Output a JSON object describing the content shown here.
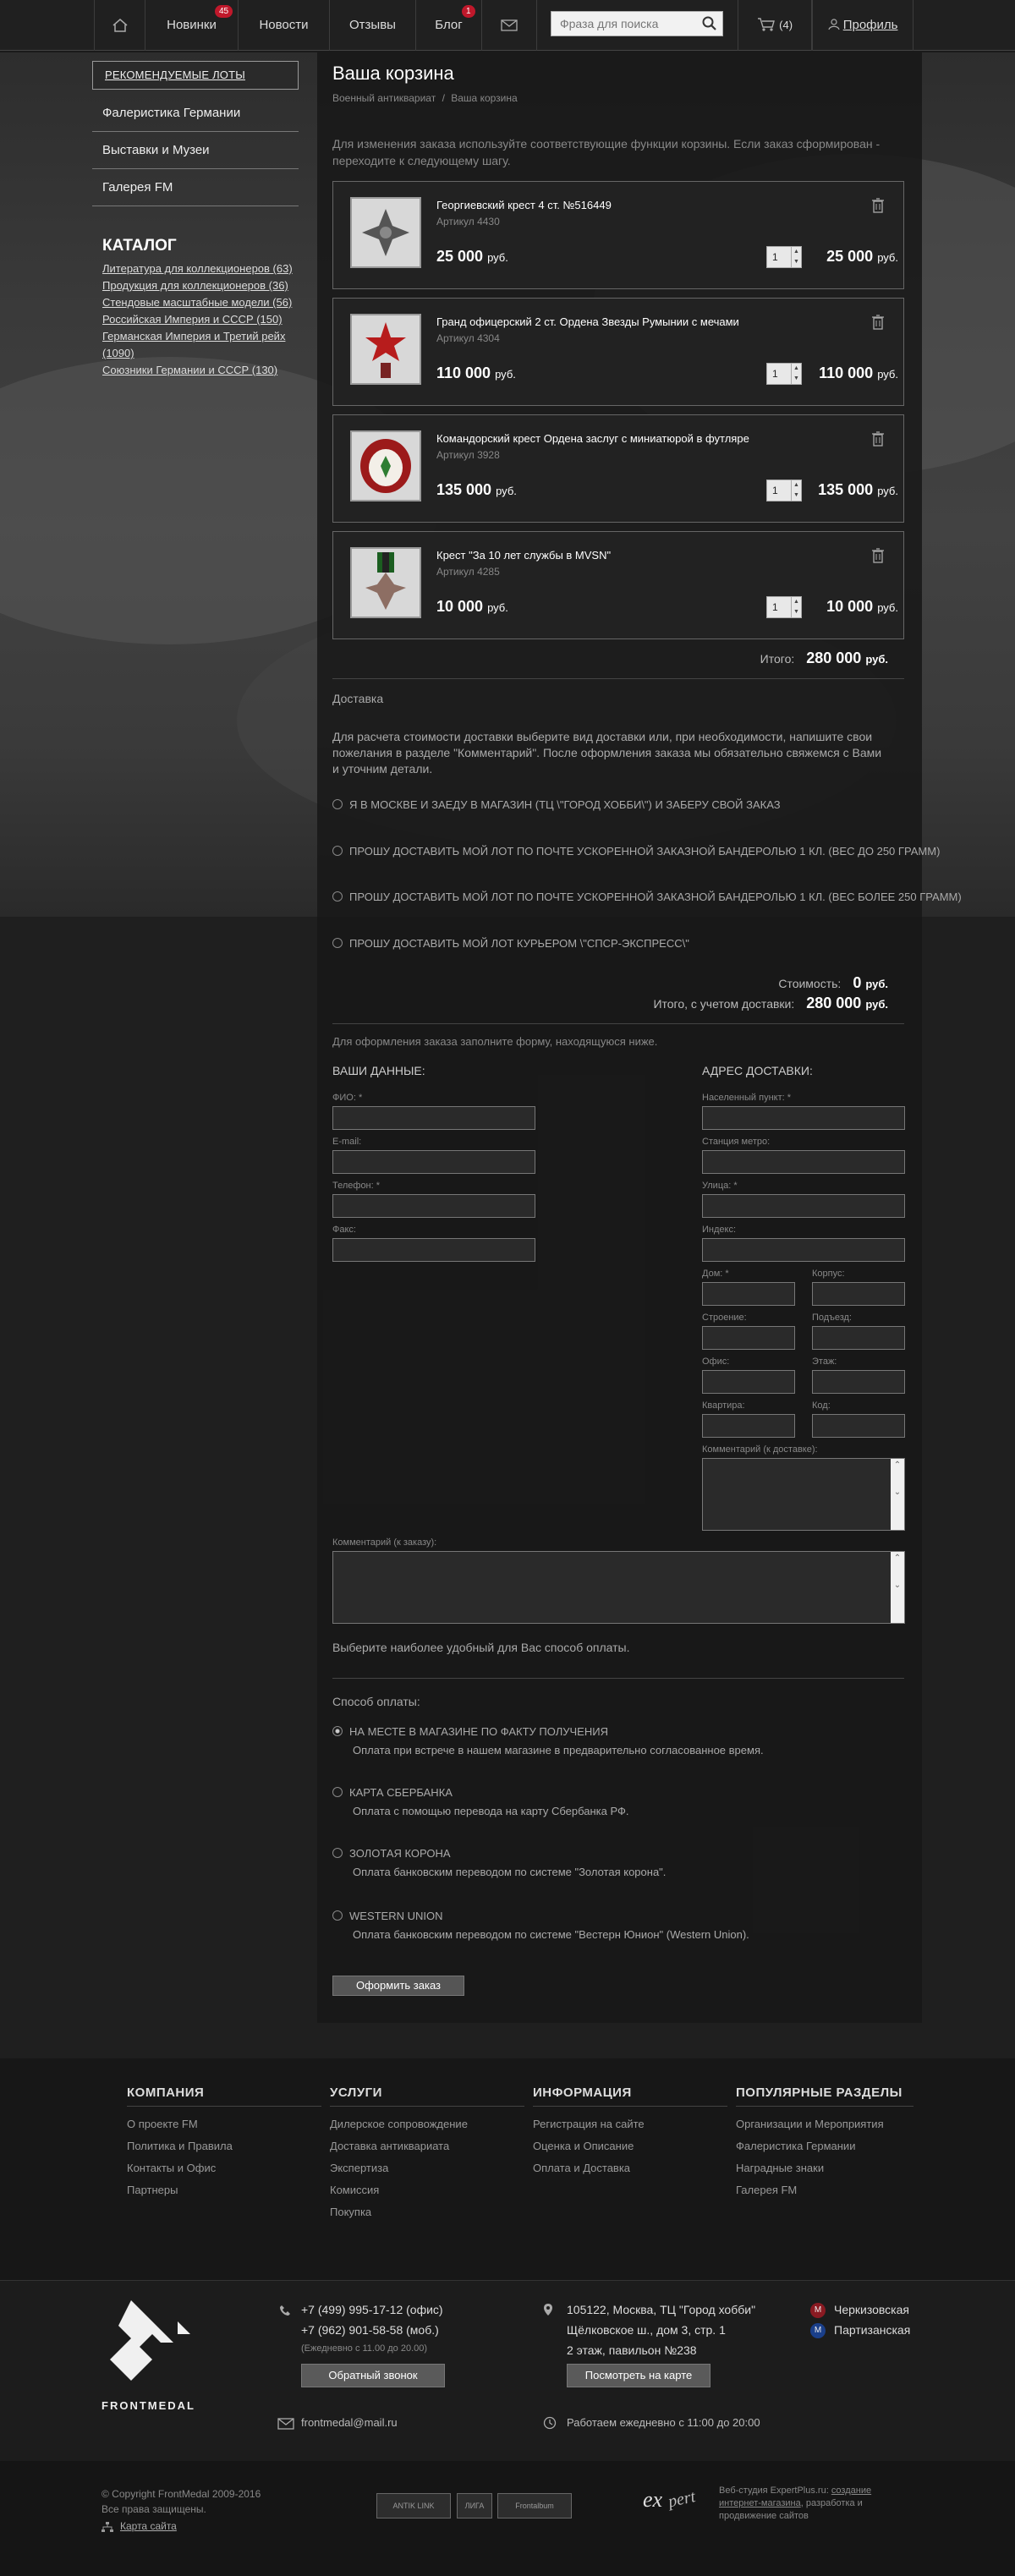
{
  "nav": {
    "items": [
      {
        "label": "Новинки",
        "badge": "45"
      },
      {
        "label": "Новости"
      },
      {
        "label": "Отзывы"
      },
      {
        "label": "Блог",
        "badge": "1"
      }
    ],
    "search_placeholder": "Фраза для поиска",
    "cart_count": "(4)",
    "profile_label": "Профиль"
  },
  "sidebar": {
    "recommended": "РЕКОМЕНДУЕМЫЕ ЛОТЫ",
    "links": [
      "Фалеристика Германии",
      "Выставки и Музеи",
      "Галерея FM"
    ],
    "catalog_title": "КАТАЛОГ",
    "catalog": [
      "Литература для коллекционеров (63)",
      "Продукция для коллекционеров (36)",
      "Стендовые масштабные модели (56)",
      "Российская Империя и СССР (150)",
      "Германская Империя и Третий рейх",
      "(1090)",
      "Союзники Германии и СССР (130)"
    ]
  },
  "cart": {
    "title": "Ваша корзина",
    "breadcrumb": [
      "Военный антиквариат",
      "/",
      "Ваша корзина"
    ],
    "intro": "Для изменения заказа используйте соответствующие функции корзины. Если заказ сформирован - переходите к следующему шагу.",
    "items": [
      {
        "name": "Георгиевский крест 4 ст. №516449",
        "article": "Артикул 4430",
        "price": "25 000",
        "currency": "руб.",
        "qty": "1",
        "total": "25 000"
      },
      {
        "name": "Гранд офицерский 2 ст. Ордена Звезды Румынии с мечами",
        "article": "Артикул 4304",
        "price": "110 000",
        "currency": "руб.",
        "qty": "1",
        "total": "110 000"
      },
      {
        "name": "Командорский крест Ордена заслуг с миниатюрой в футляре",
        "article": "Артикул 3928",
        "price": "135 000",
        "currency": "руб.",
        "qty": "1",
        "total": "135 000"
      },
      {
        "name": "Крест \"За 10 лет службы в MVSN\"",
        "article": "Артикул 4285",
        "price": "10 000",
        "currency": "руб.",
        "qty": "1",
        "total": "10 000"
      }
    ],
    "total_label": "Итого:",
    "total_value": "280 000",
    "currency": "руб."
  },
  "delivery": {
    "title": "Доставка",
    "text": "Для расчета стоимости доставки выберите вид доставки или, при необходимости, напишите свои пожелания в разделе \"Комментарий\". После оформления заказа мы обязательно свяжемся с Вами и уточним детали.",
    "options": [
      "Я В МОСКВЕ И ЗАЕДУ В МАГАЗИН (ТЦ \\\"ГОРОД ХОББИ\\\") И ЗАБЕРУ СВОЙ ЗАКАЗ",
      "ПРОШУ ДОСТАВИТЬ МОЙ ЛОТ ПО ПОЧТЕ УСКОРЕННОЙ ЗАКАЗНОЙ БАНДЕРОЛЬЮ 1 КЛ. (ВЕС ДО 250 ГРАММ)",
      "ПРОШУ ДОСТАВИТЬ МОЙ ЛОТ ПО ПОЧТЕ УСКОРЕННОЙ ЗАКАЗНОЙ БАНДЕРОЛЬЮ 1 КЛ. (ВЕС БОЛЕЕ 250 ГРАММ)",
      "ПРОШУ ДОСТАВИТЬ МОЙ ЛОТ КУРЬЕРОМ \\\"СПСР-ЭКСПРЕСС\\\""
    ],
    "cost_label": "Стоимость:",
    "cost_value": "0",
    "grand_label": "Итого, с учетом доставки:",
    "grand_value": "280 000",
    "currency": "руб."
  },
  "form": {
    "intro": "Для оформления заказа заполните форму, находящуюся ниже.",
    "your_data": "ВАШИ ДАННЫЕ:",
    "address_title": "АДРЕС ДОСТАВКИ:",
    "left_fields": [
      "ФИО: *",
      "E-mail:",
      "Телефон: *",
      "Факс:"
    ],
    "right_fields": [
      "Населенный пункт: *",
      "Станция метро:",
      "Улица: *",
      "Индекс:"
    ],
    "pairs": [
      [
        "Дом: *",
        "Корпус:"
      ],
      [
        "Строение:",
        "Подъезд:"
      ],
      [
        "Офис:",
        "Этаж:"
      ],
      [
        "Квартира:",
        "Код:"
      ]
    ],
    "delivery_comment": "Комментарий (к доставке):",
    "order_comment": "Комментарий (к заказу):"
  },
  "payment": {
    "prompt": "Выберите наиболее удобный для Вас способ оплаты.",
    "title": "Способ оплаты:",
    "options": [
      {
        "label": "НА МЕСТЕ В МАГАЗИНЕ ПО ФАКТУ ПОЛУЧЕНИЯ",
        "desc": "Оплата при встрече в нашем магазине в предварительно согласованное время."
      },
      {
        "label": "КАРТА СБЕРБАНКА",
        "desc": "Оплата с помощью перевода на карту Сбербанка РФ."
      },
      {
        "label": "ЗОЛОТАЯ КОРОНА",
        "desc": "Оплата банковским переводом по системе \"Золотая корона\"."
      },
      {
        "label": "WESTERN UNION",
        "desc": "Оплата банковским переводом по системе \"Вестерн Юнион\" (Western Union)."
      }
    ],
    "submit": "Оформить заказ"
  },
  "footer": {
    "columns": [
      {
        "title": "КОМПАНИЯ",
        "links": [
          "О проекте FM",
          "Политика и Правила",
          "Контакты и Офис",
          "Партнеры"
        ]
      },
      {
        "title": "УСЛУГИ",
        "links": [
          "Дилерское сопровождение",
          "Доставка антиквариата",
          "Экспертиза",
          "Комиссия",
          "Покупка"
        ]
      },
      {
        "title": "ИНФОРМАЦИЯ",
        "links": [
          "Регистрация на сайте",
          "Оценка и Описание",
          "Оплата и Доставка"
        ]
      },
      {
        "title": "ПОПУЛЯРНЫЕ РАЗДЕЛЫ",
        "links": [
          "Организации и Мероприятия",
          "Фалеристика Германии",
          "Наградные знаки",
          "Галерея FM"
        ]
      }
    ],
    "logo_text": "FRONTMEDAL",
    "phone1": "+7 (499) 995-17-12 (офис)",
    "phone2": "+7 (962) 901-58-58 (моб.)",
    "hours_note": "(Ежедневно с 11.00 до 20.00)",
    "callback": "Обратный звонок",
    "address1": "105122, Москва, ТЦ \"Город хобби\"",
    "address2": "Щёлковское ш., дом 3, стр. 1",
    "address3": "2 этаж, павильон №238",
    "map_btn": "Посмотреть на карте",
    "metro1": "Черкизовская",
    "metro2": "Партизанская",
    "email": "frontmedal@mail.ru",
    "schedule": "Работаем ежедневно с 11:00 до 20:00",
    "copyright": "© Copyright FrontMedal 2009-2016",
    "rights": "Все права защищены.",
    "sitemap": "Карта сайта",
    "studio_prefix": "Веб-студия ExpertPlus.ru:",
    "studio_link": "создание интернет-магазина",
    "studio_suffix": ", разработка и продвижение сайтов",
    "partners": [
      "ANTIK LINK",
      "ЛИГА",
      "Frontalbum"
    ]
  },
  "colors": {
    "accent": "#c0182b",
    "bg": "#1a1a1a"
  }
}
